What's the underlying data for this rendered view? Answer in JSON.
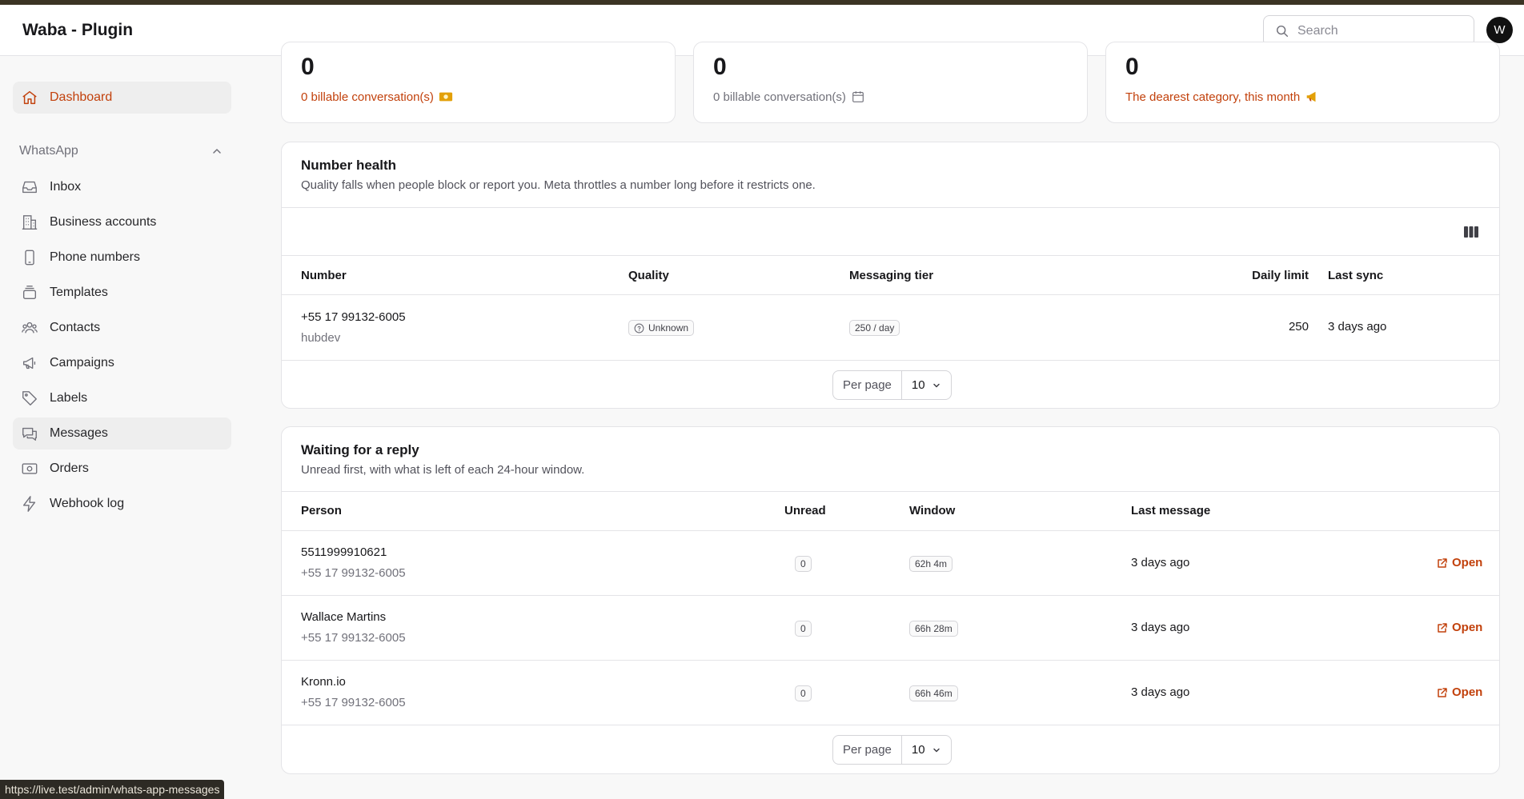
{
  "app": {
    "title": "Waba - Plugin",
    "avatar_initial": "W"
  },
  "search": {
    "placeholder": "Search",
    "value": ""
  },
  "sidebar": {
    "dashboard": "Dashboard",
    "group": "WhatsApp",
    "items": [
      {
        "label": "Inbox",
        "icon": "inbox-icon"
      },
      {
        "label": "Business accounts",
        "icon": "building-icon"
      },
      {
        "label": "Phone numbers",
        "icon": "phone-icon"
      },
      {
        "label": "Templates",
        "icon": "stack-icon"
      },
      {
        "label": "Contacts",
        "icon": "users-icon"
      },
      {
        "label": "Campaigns",
        "icon": "megaphone-icon"
      },
      {
        "label": "Labels",
        "icon": "tag-icon"
      },
      {
        "label": "Messages",
        "icon": "chat-icon"
      },
      {
        "label": "Orders",
        "icon": "cash-icon"
      },
      {
        "label": "Webhook log",
        "icon": "bolt-icon"
      }
    ]
  },
  "stats": [
    {
      "value": "0",
      "desc": "0 billable conversation(s)",
      "icon": "money-icon"
    },
    {
      "value": "0",
      "desc": "0 billable conversation(s)",
      "icon": "calendar-icon"
    },
    {
      "value": "0",
      "desc": "The dearest category, this month",
      "icon": "megaphone-icon"
    }
  ],
  "number_health": {
    "title": "Number health",
    "description": "Quality falls when people block or report you. Meta throttles a number long before it restricts one.",
    "columns": [
      "Number",
      "Quality",
      "Messaging tier",
      "Daily limit",
      "Last sync"
    ],
    "rows": [
      {
        "number": "+55 17 99132-6005",
        "name": "hubdev",
        "quality": "Unknown",
        "tier": "250 / day",
        "daily_limit": "250",
        "last_sync": "3 days ago"
      }
    ],
    "per_page_label": "Per page",
    "per_page": "10"
  },
  "waiting": {
    "title": "Waiting for a reply",
    "description": "Unread first, with what is left of each 24-hour window.",
    "columns": [
      "Person",
      "Unread",
      "Window",
      "Last message"
    ],
    "rows": [
      {
        "person": "5511999910621",
        "number": "+55 17 99132-6005",
        "unread": "0",
        "window": "62h 4m",
        "last_message": "3 days ago",
        "action": "Open"
      },
      {
        "person": "Wallace Martins",
        "number": "+55 17 99132-6005",
        "unread": "0",
        "window": "66h 28m",
        "last_message": "3 days ago",
        "action": "Open"
      },
      {
        "person": "Kronn.io",
        "number": "+55 17 99132-6005",
        "unread": "0",
        "window": "66h 46m",
        "last_message": "3 days ago",
        "action": "Open"
      }
    ],
    "per_page_label": "Per page",
    "per_page": "10"
  },
  "status_url": "https://live.test/admin/whats-app-messages"
}
